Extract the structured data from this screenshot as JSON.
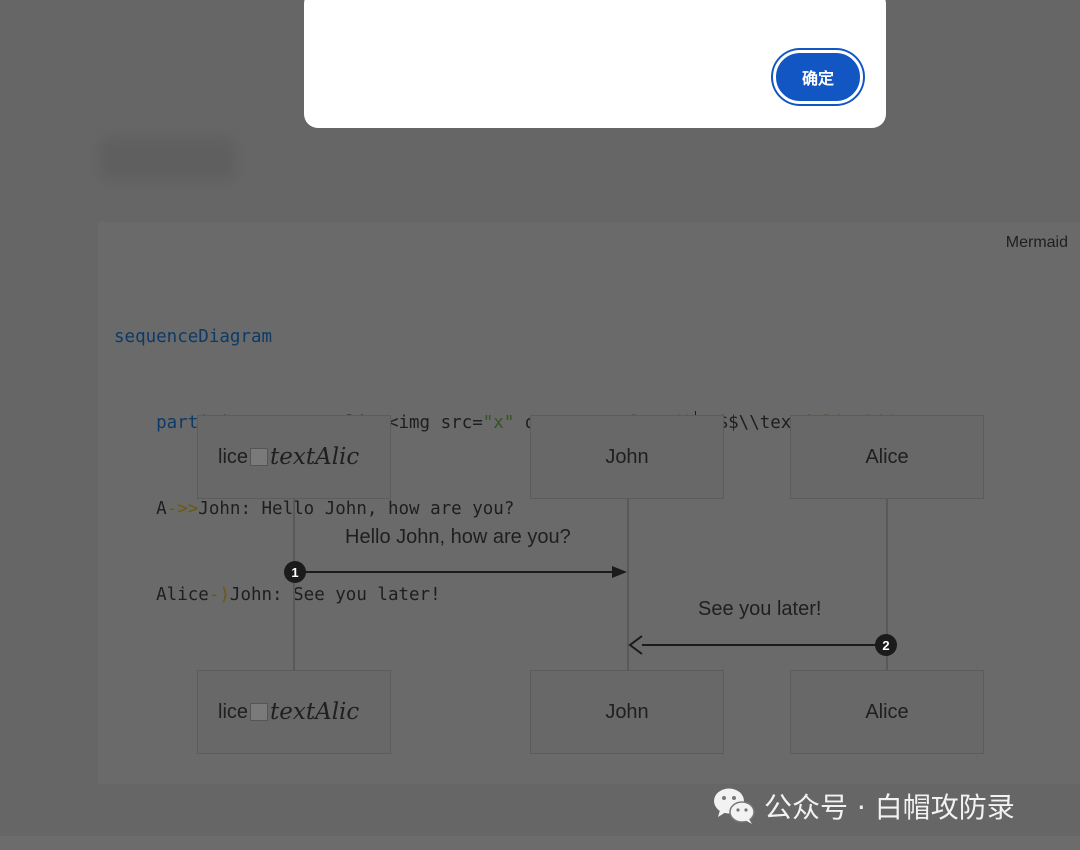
{
  "dialog": {
    "confirm_label": "确定"
  },
  "code_block": {
    "language": "Mermaid",
    "lines": [
      "sequenceDiagram",
      "    participant A as Alice<img src=\"x\" onerror=\"alert()\">$$\\\\text{Alice}$$",
      "    A->>John: Hello John, how are you?",
      "    Alice-)John: See you later!"
    ]
  },
  "diagram": {
    "actors": {
      "a_prefix": "lice",
      "a_italic": "textAlic",
      "john": "John",
      "alice": "Alice"
    },
    "messages": [
      {
        "seq": "1",
        "text": "Hello John, how are you?"
      },
      {
        "seq": "2",
        "text": "See you later!"
      }
    ]
  },
  "watermark": {
    "text": "公众号 · 白帽攻防录",
    "icon": "wechat-icon"
  }
}
